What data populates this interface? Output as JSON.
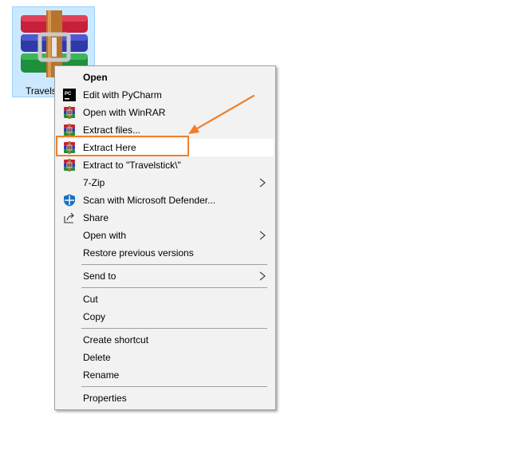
{
  "desktop_file": {
    "name": "Travelstick",
    "visible_label": "Travelst",
    "icon": "winrar-archive-icon"
  },
  "context_menu": {
    "items": [
      {
        "label": "Open",
        "bold": true,
        "icon": null,
        "submenu": false
      },
      {
        "label": "Edit with PyCharm",
        "icon": "pycharm-icon",
        "submenu": false
      },
      {
        "label": "Open with WinRAR",
        "icon": "winrar-icon",
        "submenu": false
      },
      {
        "label": "Extract files...",
        "icon": "winrar-icon",
        "submenu": false
      },
      {
        "label": "Extract Here",
        "icon": "winrar-icon",
        "submenu": false,
        "highlighted": true
      },
      {
        "label": "Extract to \"Travelstick\\\"",
        "icon": "winrar-icon",
        "submenu": false
      },
      {
        "label": "7-Zip",
        "icon": null,
        "submenu": true
      },
      {
        "label": "Scan with Microsoft Defender...",
        "icon": "defender-shield-icon",
        "submenu": false
      },
      {
        "label": "Share",
        "icon": "share-icon",
        "submenu": false
      },
      {
        "label": "Open with",
        "icon": null,
        "submenu": true
      },
      {
        "label": "Restore previous versions",
        "icon": null,
        "submenu": false
      },
      {
        "label": "Send to",
        "icon": null,
        "submenu": true
      },
      {
        "label": "Cut",
        "icon": null,
        "submenu": false
      },
      {
        "label": "Copy",
        "icon": null,
        "submenu": false
      },
      {
        "label": "Create shortcut",
        "icon": null,
        "submenu": false
      },
      {
        "label": "Delete",
        "icon": null,
        "submenu": false
      },
      {
        "label": "Rename",
        "icon": null,
        "submenu": false
      },
      {
        "label": "Properties",
        "icon": null,
        "submenu": false
      }
    ]
  },
  "annotation": {
    "color": "#f07f2c",
    "target": "Extract Here"
  }
}
